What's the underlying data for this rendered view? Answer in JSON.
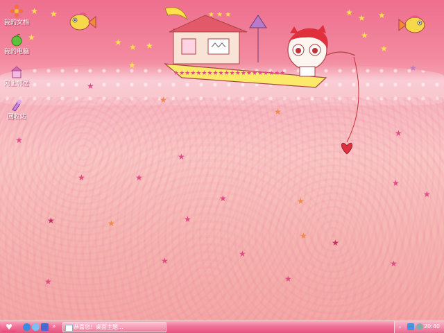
{
  "desktop": {
    "icons": [
      {
        "label": "我的文档",
        "icon": "my-documents-icon"
      },
      {
        "label": "我的电脑",
        "icon": "my-computer-icon"
      },
      {
        "label": "网上邻居",
        "icon": "network-places-icon"
      },
      {
        "label": "回收站",
        "icon": "recycle-bin-icon"
      }
    ],
    "wallpaper": "pink-cartoon-boat-fishing"
  },
  "taskbar": {
    "start_icon": "heart-icon",
    "quicklaunch_chevron": "»",
    "task_label": "恭喜您！桌面主题...",
    "clock": "20:40",
    "colors": {
      "bar": "#e5547f",
      "accent": "#f8a8c0"
    }
  }
}
